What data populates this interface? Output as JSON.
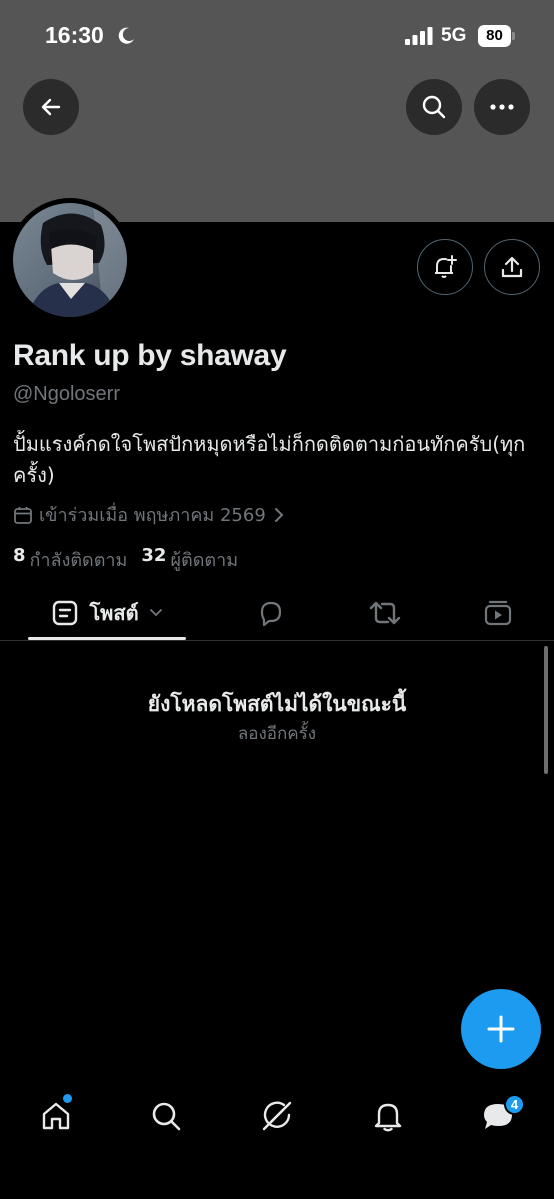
{
  "status_bar": {
    "time": "16:30",
    "network": "5G",
    "battery": "80"
  },
  "profile": {
    "display_name": "Rank up by shaway",
    "handle": "@Ngoloserr",
    "bio": "ปั้มแรงค์กดใจโพสปักหมุดหรือไม่ก็กดติดตามก่อนทักครับ(ทุกครั้ง)",
    "joined": "เข้าร่วมเมื่อ พฤษภาคม 2569",
    "following_count": "8",
    "following_label": "กำลังติดตาม",
    "followers_count": "32",
    "followers_label": "ผู้ติดตาม"
  },
  "tabs": {
    "posts_label": "โพสต์"
  },
  "empty_state": {
    "title": "ยังโหลดโพสต์ไม่ได้ในขณะนี้",
    "subtitle": "ลองอีกครั้ง"
  },
  "bottom_nav": {
    "messages_badge": "4"
  },
  "colors": {
    "accent": "#1d9bf0",
    "banner": "#555555",
    "background": "#000000",
    "secondary_text": "#71767b"
  },
  "icons": [
    "moon-icon",
    "signal-icon",
    "back-arrow-icon",
    "search-icon",
    "more-icon",
    "bell-plus-icon",
    "share-icon",
    "calendar-icon",
    "chevron-right-icon",
    "posts-icon",
    "chevron-down-icon",
    "reply-icon",
    "repost-icon",
    "media-icon",
    "plus-icon",
    "home-icon",
    "grok-icon",
    "bell-icon",
    "messages-icon"
  ]
}
